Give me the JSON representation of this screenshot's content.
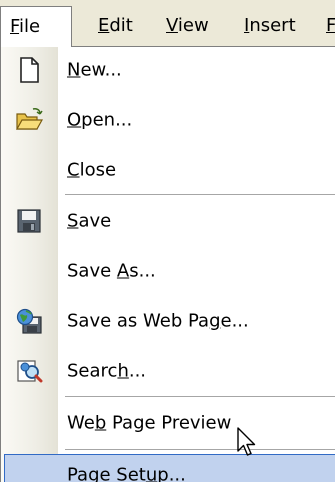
{
  "menubar": {
    "items": [
      {
        "pre": "",
        "key": "F",
        "post": "ile"
      },
      {
        "pre": "",
        "key": "E",
        "post": "dit"
      },
      {
        "pre": "",
        "key": "V",
        "post": "iew"
      },
      {
        "pre": "",
        "key": "I",
        "post": "nsert"
      },
      {
        "pre": "",
        "key": "F",
        "post": ""
      }
    ]
  },
  "file_menu": {
    "items": [
      {
        "pre": "",
        "key": "N",
        "post": "ew...",
        "icon": "new-document-icon"
      },
      {
        "pre": "",
        "key": "O",
        "post": "pen...",
        "icon": "open-folder-icon"
      },
      {
        "pre": "",
        "key": "C",
        "post": "lose",
        "icon": ""
      },
      {
        "pre": "",
        "key": "S",
        "post": "ave",
        "icon": "save-disk-icon"
      },
      {
        "pre": "Save ",
        "key": "A",
        "post": "s...",
        "icon": ""
      },
      {
        "pre": "Save as Web Pa",
        "key": "g",
        "post": "e...",
        "icon": "save-as-web-page-icon"
      },
      {
        "pre": "Searc",
        "key": "h",
        "post": "...",
        "icon": "search-icon"
      },
      {
        "pre": "We",
        "key": "b",
        "post": " Page Preview",
        "icon": ""
      },
      {
        "pre": "Page Set",
        "key": "u",
        "post": "p...",
        "icon": ""
      }
    ],
    "highlighted_item": "Page Setup..."
  },
  "colors": {
    "menubar_bg": "#ece9d8",
    "highlight_bg": "#c1d2ee",
    "highlight_border": "#316ac5"
  }
}
